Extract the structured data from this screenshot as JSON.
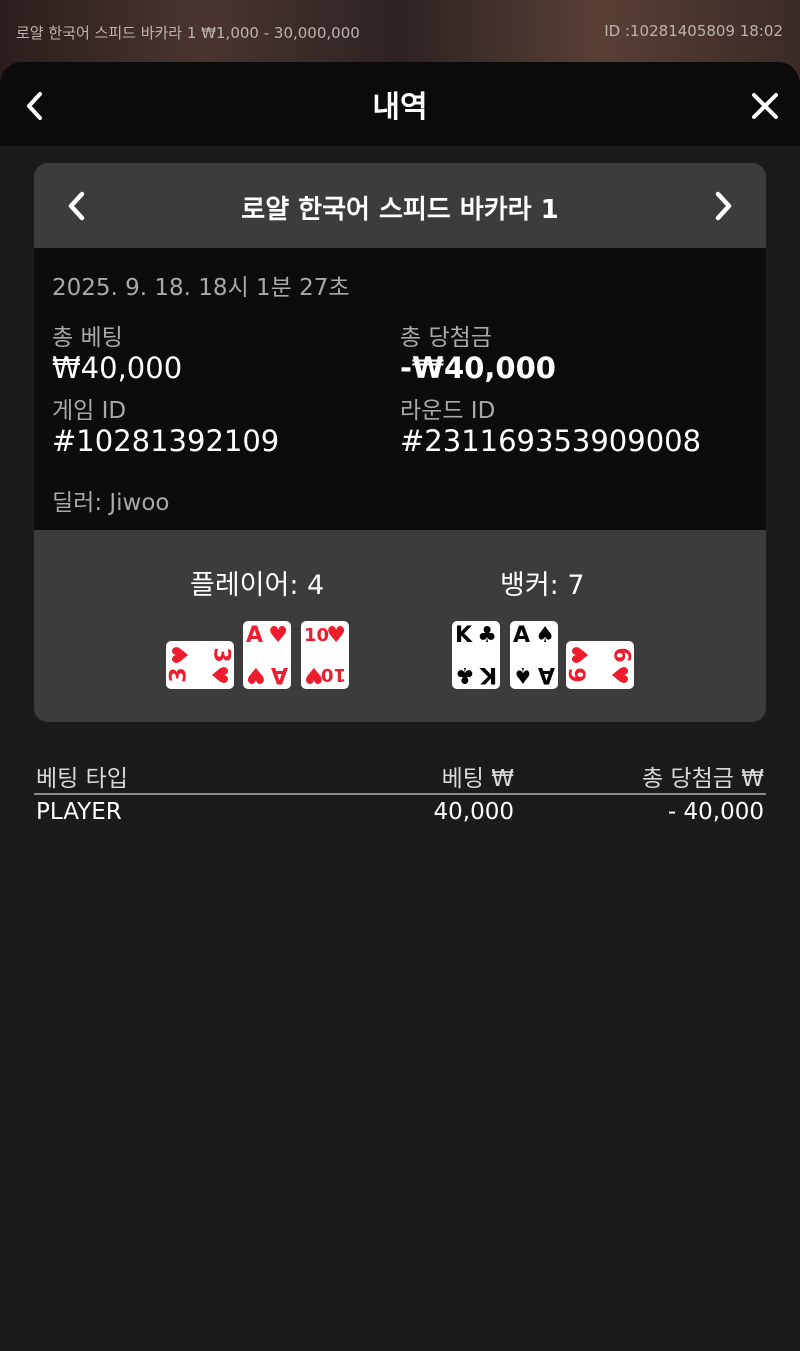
{
  "background": {
    "left_text": "로얄 한국어 스피드 바카라 1 ₩1,000 - 30,000,000",
    "right_text": "ID :10281405809 18:02"
  },
  "header": {
    "title": "내역",
    "back_icon": "chevron-left-icon",
    "close_icon": "close-icon"
  },
  "card": {
    "title": "로얄 한국어 스피드 바카라 1",
    "date": "2025. 9. 18. 18시 1분 27초",
    "total_bet_label": "총 베팅",
    "total_bet_value": "₩40,000",
    "total_win_label": "총 당첨금",
    "total_win_value": "-₩40,000",
    "game_id_label": "게임 ID",
    "game_id_value": "#10281392109",
    "round_id_label": "라운드 ID",
    "round_id_value": "#231169353909008",
    "dealer": "딜러: Jiwoo"
  },
  "result": {
    "player_label": "플레이어: 4",
    "banker_label": "뱅커: 7",
    "player_cards": [
      {
        "rank": "3",
        "suit": "♥",
        "color": "#ee1d2d",
        "rotated": true
      },
      {
        "rank": "A",
        "suit": "♥",
        "color": "#ee1d2d",
        "rotated": false
      },
      {
        "rank": "10",
        "suit": "♥",
        "color": "#ee1d2d",
        "rotated": false
      }
    ],
    "banker_cards": [
      {
        "rank": "K",
        "suit": "♣",
        "color": "#000000",
        "rotated": false
      },
      {
        "rank": "A",
        "suit": "♠",
        "color": "#000000",
        "rotated": false
      },
      {
        "rank": "6",
        "suit": "♥",
        "color": "#ee1d2d",
        "rotated": true
      }
    ]
  },
  "table": {
    "headers": [
      "베팅 타입",
      "베팅 ₩",
      "총 당첨금 ₩"
    ],
    "rows": [
      [
        "PLAYER",
        "40,000",
        "- 40,000"
      ]
    ]
  }
}
